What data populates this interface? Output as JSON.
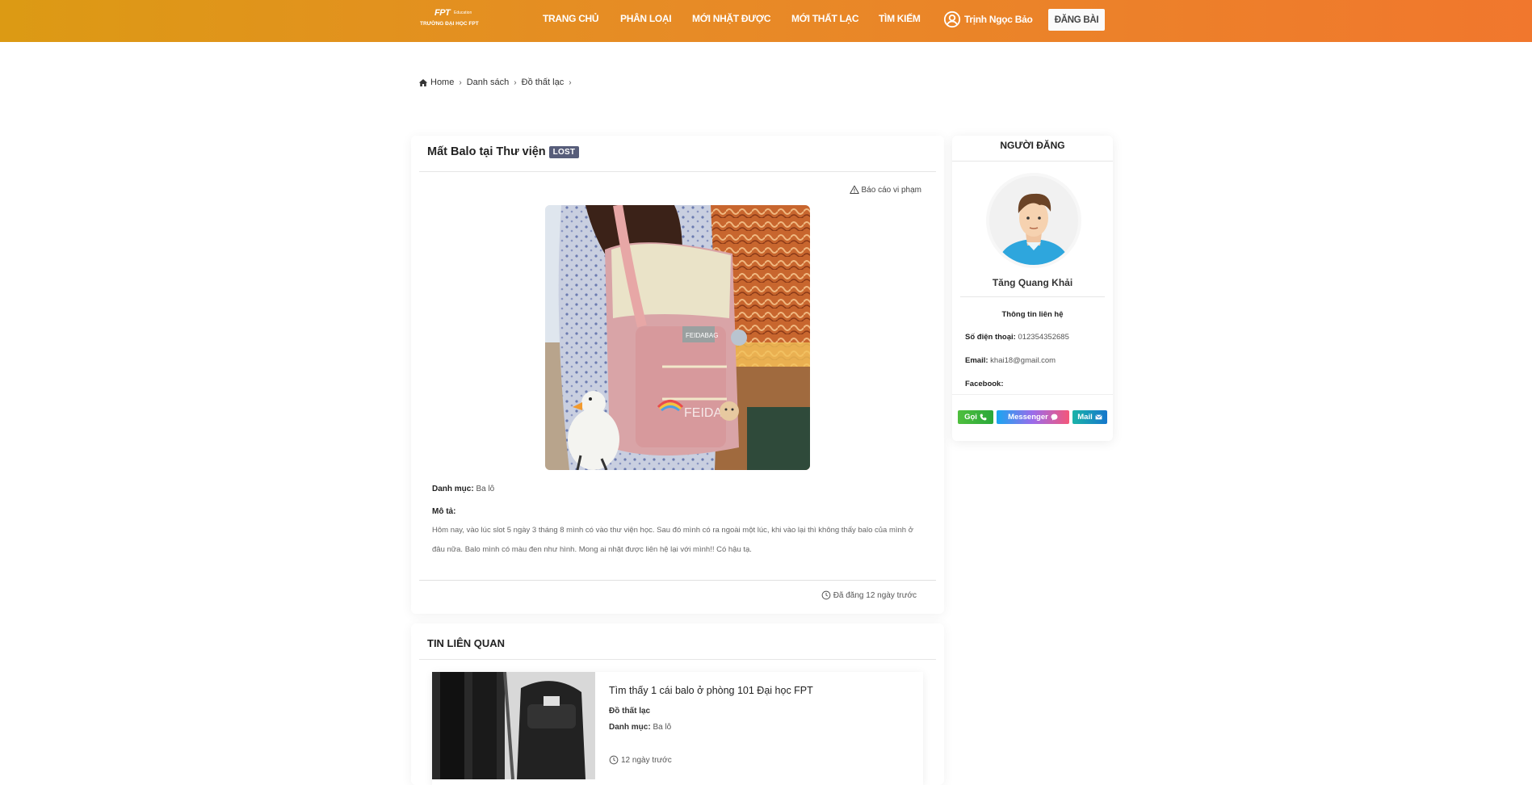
{
  "navbar": {
    "logo": {
      "mark": "FPT",
      "sub": "Education",
      "text": "TRƯỜNG ĐẠI HỌC FPT"
    },
    "links": [
      "TRANG CHỦ",
      "PHÂN LOẠI",
      "MỚI NHẶT ĐƯỢC",
      "MỚI THẤT LẠC",
      "TÌM KIẾM"
    ],
    "user_name": "Trịnh Ngọc Bảo",
    "post_button": "ĐĂNG BÀI"
  },
  "breadcrumb": [
    "Home",
    "Danh sách",
    "Đồ thất lạc"
  ],
  "post": {
    "title": "Mất Balo tại Thư viện",
    "badge": "LOST",
    "report_label": "Báo cáo vi phạm",
    "image_text": {
      "patch": "FEIDABAG",
      "brand": "FEIDA"
    },
    "category_label": "Danh mục:",
    "category_value": "Ba lô",
    "description_label": "Mô tả:",
    "description": "Hôm nay, vào lúc slot 5 ngày 3 tháng 8 mình có vào thư viện học. Sau đó mình có ra ngoài một lúc, khi vào lại thì không thấy balo của mình ở đâu nữa. Balo mình có màu đen như hình. Mong ai nhặt được liên hệ lại với mình!! Có hậu tạ.",
    "posted_ago": "Đã đăng 12 ngày trước"
  },
  "related": {
    "title": "TIN LIÊN QUAN",
    "items": [
      {
        "title": "Tìm thấy 1 cái balo ở phòng 101 Đại học FPT",
        "type": "Đồ thất lạc",
        "category_label": "Danh mục:",
        "category_value": "Ba lô",
        "time": "12 ngày trước"
      }
    ]
  },
  "author": {
    "header": "NGƯỜI ĐĂNG",
    "name": "Tăng Quang Khải",
    "contact_title": "Thông tin liên hệ",
    "phone_label": "Số điện thoại:",
    "phone_value": "012354352685",
    "email_label": "Email:",
    "email_value": "khai18@gmail.com",
    "facebook_label": "Facebook:",
    "buttons": {
      "call": "Gọi",
      "messenger": "Messenger",
      "mail": "Mail"
    }
  },
  "colors": {
    "navbar_gradient": [
      "#dc9a14",
      "#f1772d"
    ],
    "badge_lost": "#575d7a",
    "call": "#2aa83a",
    "mail": "#1677cc"
  }
}
